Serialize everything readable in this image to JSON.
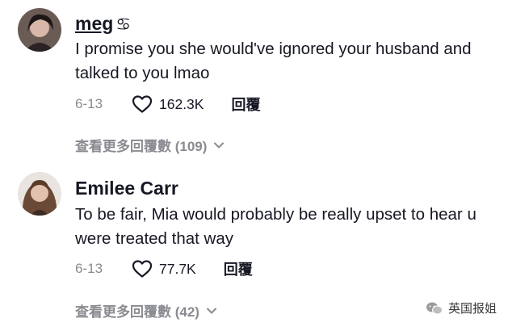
{
  "comments": [
    {
      "username": "meg",
      "username_symbol": "♋︎",
      "text": "I promise you she would've ignored your husband and talked to you lmao",
      "date": "6-13",
      "likes": "162.3K",
      "reply_label": "回覆",
      "view_replies": "查看更多回覆數 (109)"
    },
    {
      "username": "Emilee Carr",
      "text": "To be fair, Mia would probably be really upset to hear u were treated that way",
      "date": "6-13",
      "likes": "77.7K",
      "reply_label": "回覆",
      "view_replies": "查看更多回覆數 (42)"
    }
  ],
  "watermark": {
    "text": "英国报姐",
    "icon": "wechat-icon"
  },
  "colors": {
    "text": "#161823",
    "muted": "#8a8b91",
    "background": "#ffffff"
  }
}
